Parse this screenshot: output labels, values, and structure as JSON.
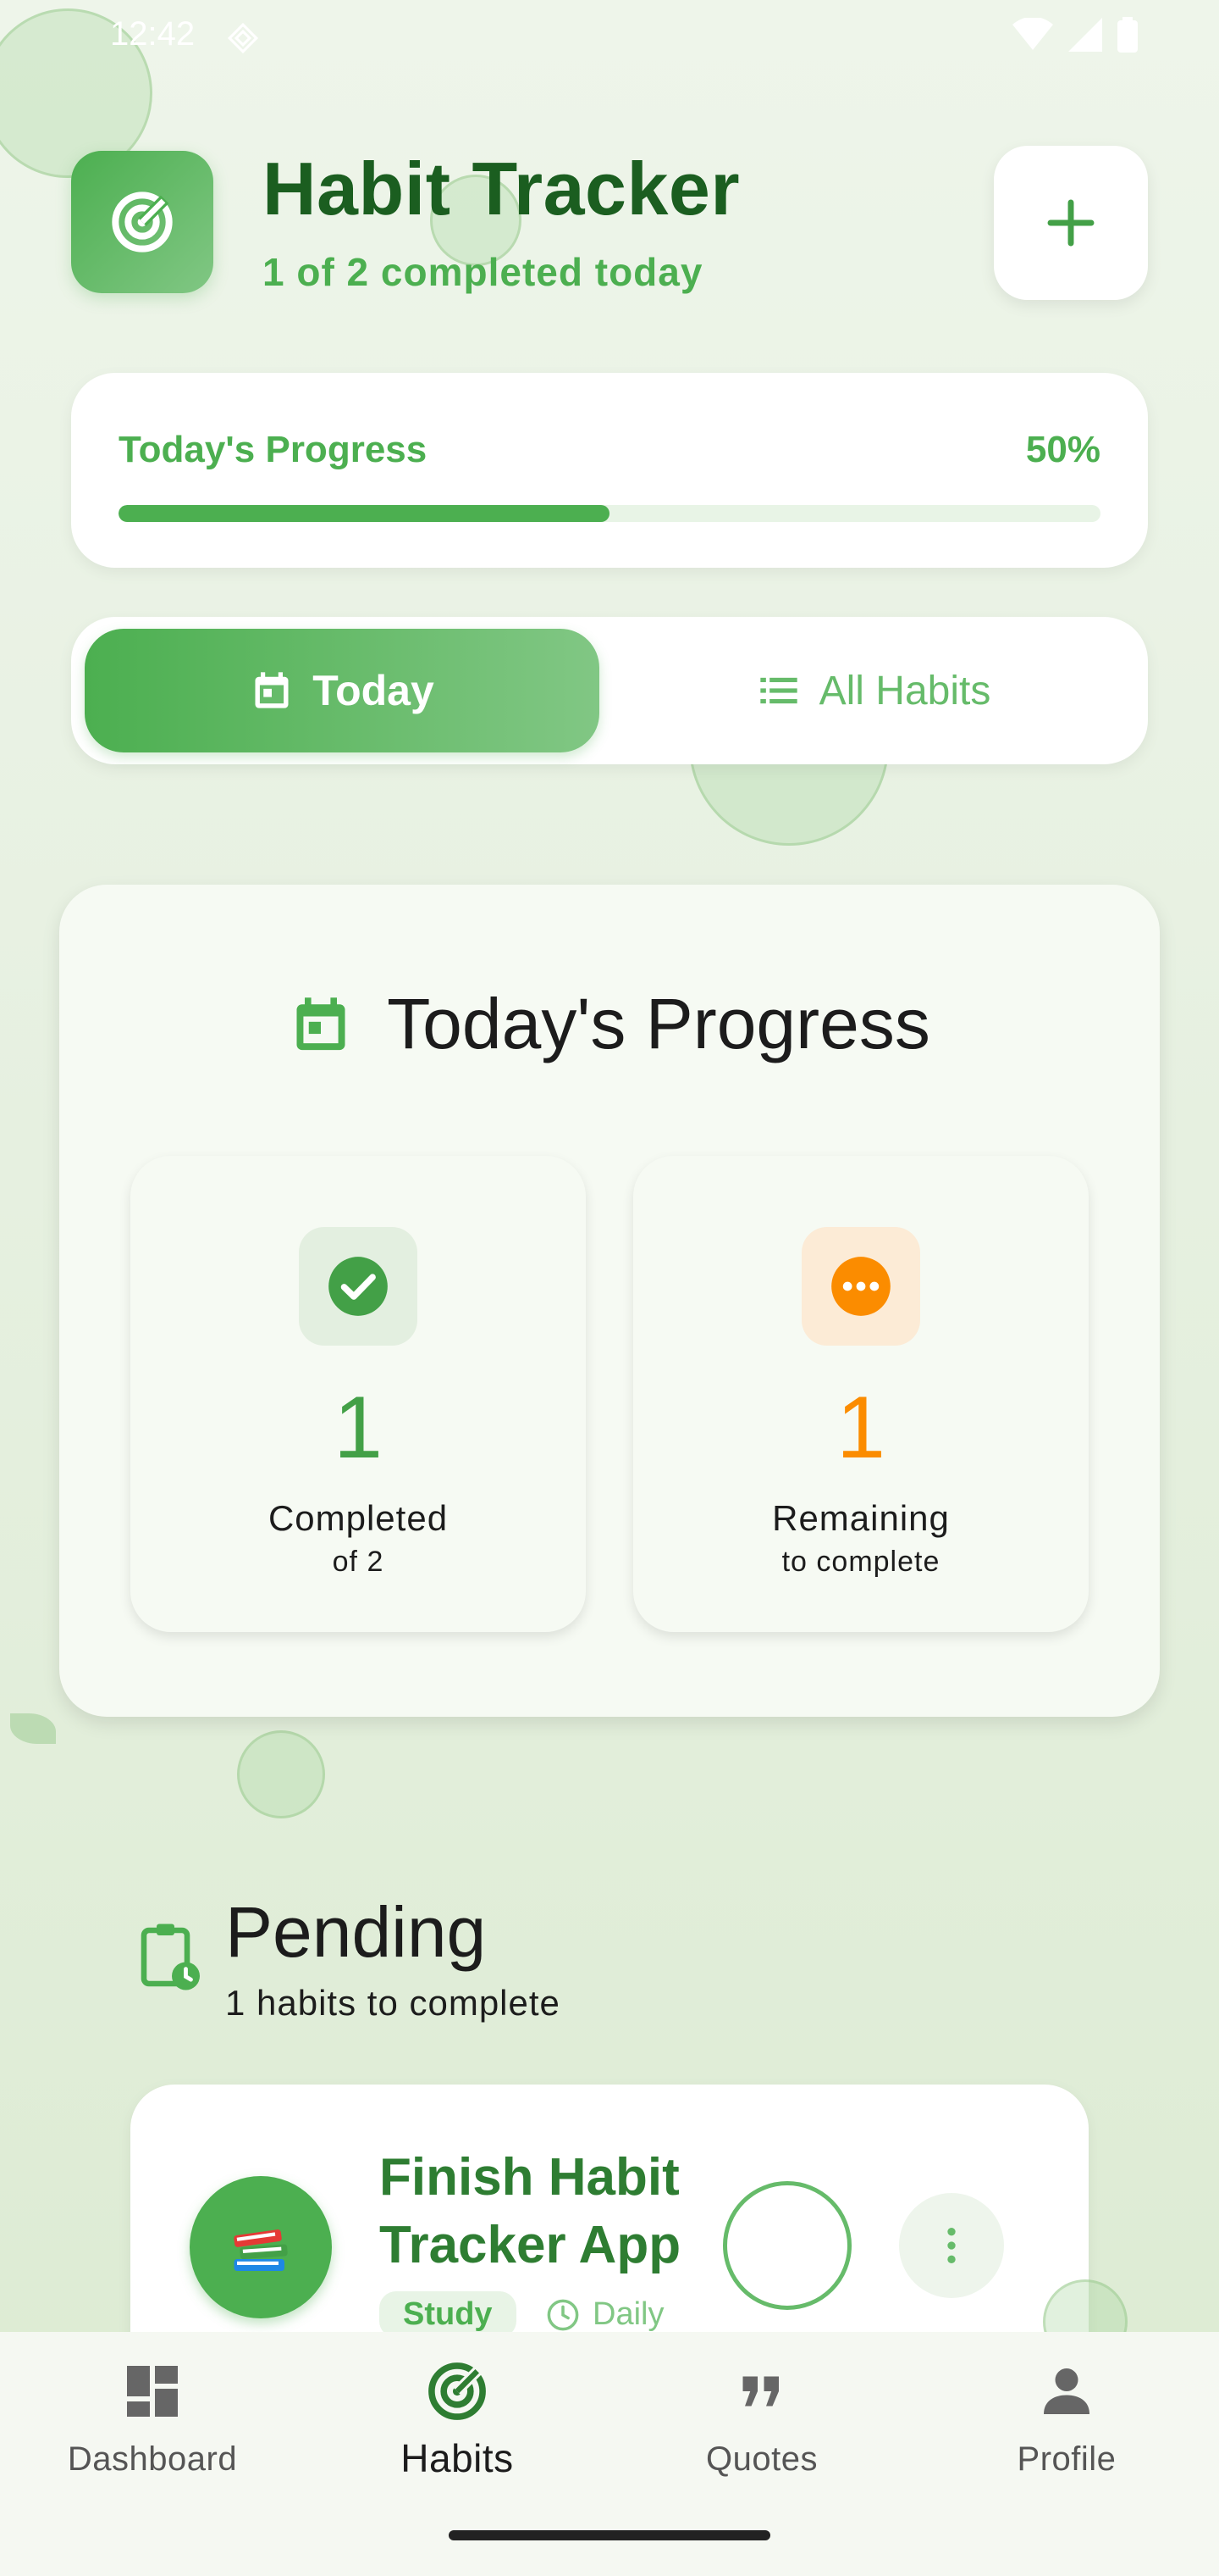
{
  "status_bar": {
    "time": "12:42"
  },
  "header": {
    "title": "Habit Tracker",
    "subtitle": "1 of 2 completed today",
    "icon": "target-icon",
    "add_button_icon": "plus-icon"
  },
  "progress": {
    "label": "Today's Progress",
    "percent_text": "50%",
    "fraction": 0.5
  },
  "tabs": [
    {
      "label": "Today",
      "icon": "calendar-icon",
      "active": true
    },
    {
      "label": "All Habits",
      "icon": "list-icon",
      "active": false
    }
  ],
  "summary": {
    "title": "Today's Progress",
    "stats": [
      {
        "value": "1",
        "label": "Completed",
        "sub": "of 2",
        "icon": "check-circle-icon",
        "color": "#43a047"
      },
      {
        "value": "1",
        "label": "Remaining",
        "sub": "to complete",
        "icon": "more-circle-icon",
        "color": "#fb8c00"
      }
    ]
  },
  "pending": {
    "title": "Pending",
    "subtitle": "1 habits to complete",
    "habits": [
      {
        "name": "Finish Habit Tracker App",
        "emoji": "📚",
        "category": "Study",
        "frequency": "Daily"
      }
    ]
  },
  "bottom_nav": [
    {
      "label": "Dashboard",
      "icon": "dashboard-icon",
      "active": false
    },
    {
      "label": "Habits",
      "icon": "target-icon",
      "active": true
    },
    {
      "label": "Quotes",
      "icon": "quote-icon",
      "active": false
    },
    {
      "label": "Profile",
      "icon": "person-icon",
      "active": false
    }
  ],
  "colors": {
    "primary": "#4caf50",
    "primary_dark": "#1b5e20",
    "accent_orange": "#fb8c00"
  }
}
